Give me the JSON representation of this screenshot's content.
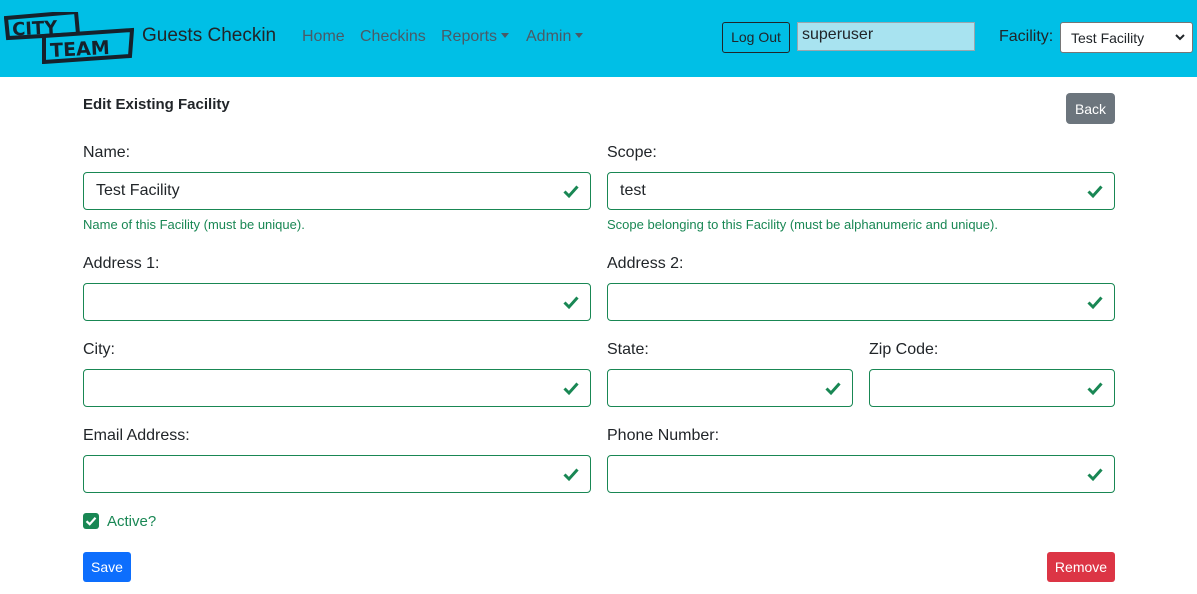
{
  "navbar": {
    "logo_text_top": "CITY",
    "logo_text_bottom": "TEAM",
    "brand": "Guests Checkin",
    "links": [
      {
        "label": "Home"
      },
      {
        "label": "Checkins"
      },
      {
        "label": "Reports"
      },
      {
        "label": "Admin"
      }
    ],
    "logout_label": "Log Out",
    "username": "superuser",
    "facility_label": "Facility:",
    "facility_selected": "Test Facility",
    "bg_color": "#00bfe6"
  },
  "form": {
    "title": "Edit Existing Facility",
    "back_label": "Back",
    "name": {
      "label": "Name:",
      "value": "Test Facility",
      "help": "Name of this Facility (must be unique)."
    },
    "scope": {
      "label": "Scope:",
      "value": "test",
      "help": "Scope belonging to this Facility (must be alphanumeric and unique)."
    },
    "address1": {
      "label": "Address 1:",
      "value": ""
    },
    "address2": {
      "label": "Address 2:",
      "value": ""
    },
    "city": {
      "label": "City:",
      "value": ""
    },
    "state": {
      "label": "State:",
      "value": ""
    },
    "zip": {
      "label": "Zip Code:",
      "value": ""
    },
    "email": {
      "label": "Email Address:",
      "value": ""
    },
    "phone": {
      "label": "Phone Number:",
      "value": ""
    },
    "active": {
      "label": "Active?",
      "checked": true
    },
    "save_label": "Save",
    "remove_label": "Remove",
    "valid_color": "#198754"
  }
}
